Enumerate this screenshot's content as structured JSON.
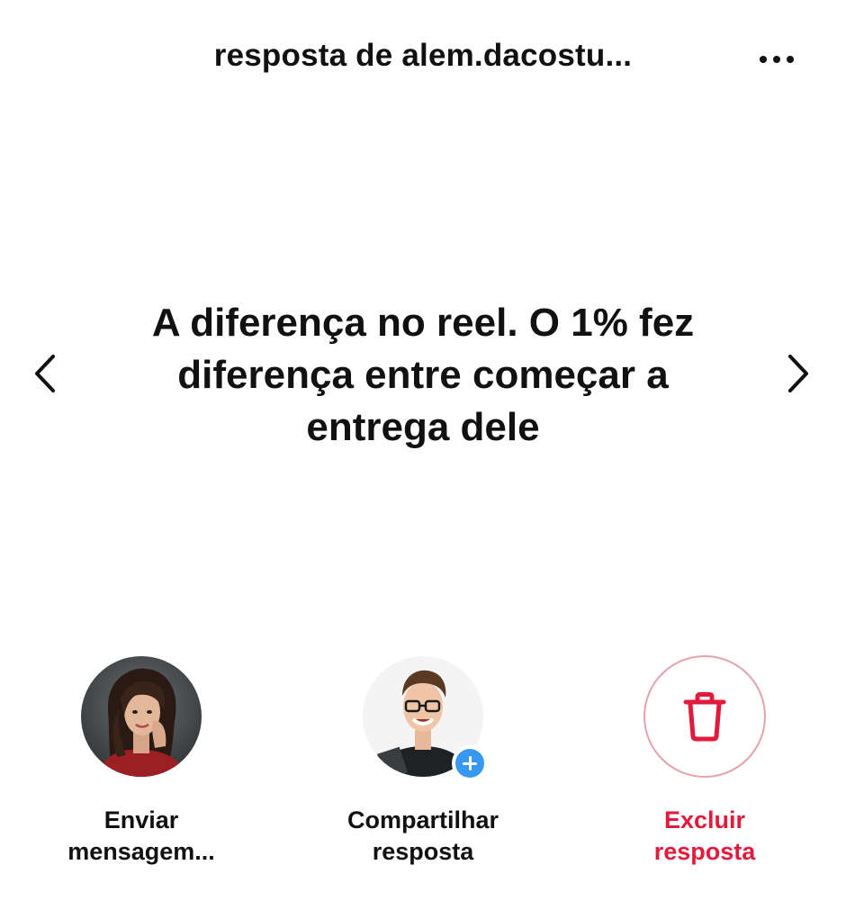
{
  "header": {
    "title": "resposta de alem.dacostu...",
    "more_icon": "more-horizontal-icon"
  },
  "navigation": {
    "prev_icon": "chevron-left-icon",
    "next_icon": "chevron-right-icon"
  },
  "response": {
    "text": "A diferença no reel.  O 1% fez diferença entre começar a entrega dele"
  },
  "actions": [
    {
      "label_line1": "Enviar",
      "label_line2": "mensagem...",
      "icon": "avatar-woman"
    },
    {
      "label_line1": "Compartilhar",
      "label_line2": "resposta",
      "icon": "avatar-man-with-plus"
    },
    {
      "label_line1": "Excluir",
      "label_line2": "resposta",
      "icon": "trash-icon",
      "color": "#e21a3b"
    }
  ],
  "colors": {
    "text": "#111111",
    "danger": "#e21a3b",
    "danger_border": "#e4a2ad",
    "badge_blue": "#3897f0"
  }
}
